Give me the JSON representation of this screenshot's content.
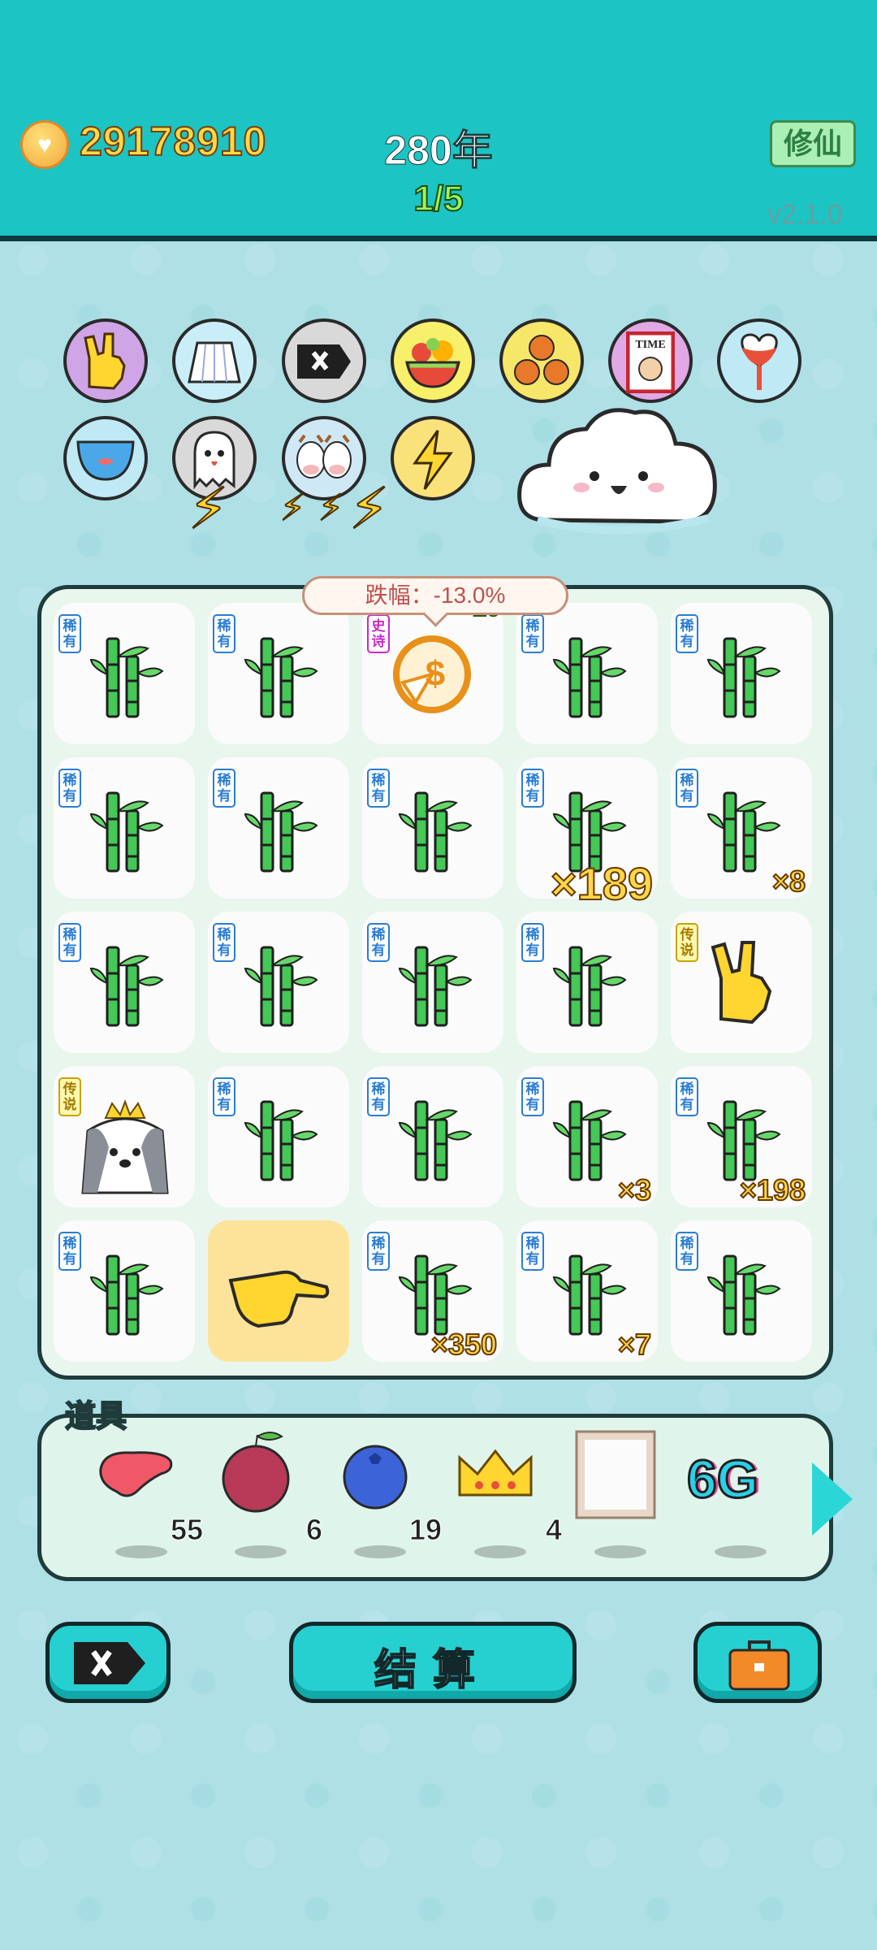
{
  "header": {
    "gold": "29178910",
    "year": "280年",
    "round": "1/5",
    "cultivate_label": "修仙",
    "version": "v2.1.0"
  },
  "powerups": [
    {
      "icon": "rock-hand-icon",
      "bg": "#cfa5e8"
    },
    {
      "icon": "skirt-icon",
      "bg": "#c9eef7"
    },
    {
      "icon": "delete-tag-icon",
      "bg": "#d9d9d9"
    },
    {
      "icon": "fruit-basket-icon",
      "bg": "#f8ef6a"
    },
    {
      "icon": "basketballs-icon",
      "bg": "#f6e66a"
    },
    {
      "icon": "time-magazine-icon",
      "bg": "#e0a8e4"
    },
    {
      "icon": "heart-potion-icon",
      "bg": "#bfe9f5"
    },
    {
      "icon": "fishbowl-icon",
      "bg": "#bfe9f5"
    },
    {
      "icon": "ghost-icon",
      "bg": "#d9d9d9"
    },
    {
      "icon": "cow-pair-icon",
      "bg": "#cfe8f5"
    },
    {
      "icon": "lightning-icon",
      "bg": "#fae27a"
    }
  ],
  "tooltip": "跌幅：-13.0%",
  "badges": {
    "rare": "稀有",
    "legend": "传说",
    "epic": "史诗"
  },
  "grid": [
    {
      "item": "bamboo",
      "badge": "稀有",
      "count": ""
    },
    {
      "item": "bamboo",
      "badge": "稀有",
      "count": ""
    },
    {
      "item": "gold-coin",
      "badge": "史诗",
      "count": "20"
    },
    {
      "item": "bamboo",
      "badge": "稀有",
      "count": ""
    },
    {
      "item": "bamboo",
      "badge": "稀有",
      "count": ""
    },
    {
      "item": "bamboo",
      "badge": "稀有",
      "count": ""
    },
    {
      "item": "bamboo",
      "badge": "稀有",
      "count": ""
    },
    {
      "item": "bamboo",
      "badge": "稀有",
      "count": ""
    },
    {
      "item": "bamboo",
      "badge": "稀有",
      "count": "×189"
    },
    {
      "item": "bamboo",
      "badge": "稀有",
      "count": "×8"
    },
    {
      "item": "bamboo",
      "badge": "稀有",
      "count": ""
    },
    {
      "item": "bamboo",
      "badge": "稀有",
      "count": ""
    },
    {
      "item": "bamboo",
      "badge": "稀有",
      "count": ""
    },
    {
      "item": "bamboo",
      "badge": "稀有",
      "count": ""
    },
    {
      "item": "rock-hand",
      "badge": "传说",
      "count": ""
    },
    {
      "item": "husky-king",
      "badge": "传说",
      "count": ""
    },
    {
      "item": "bamboo",
      "badge": "稀有",
      "count": ""
    },
    {
      "item": "bamboo",
      "badge": "稀有",
      "count": ""
    },
    {
      "item": "bamboo",
      "badge": "稀有",
      "count": "×3"
    },
    {
      "item": "bamboo",
      "badge": "稀有",
      "count": "×198"
    },
    {
      "item": "bamboo",
      "badge": "稀有",
      "count": ""
    },
    {
      "item": "pointing-hand",
      "badge": "",
      "count": ""
    },
    {
      "item": "bamboo",
      "badge": "稀有",
      "count": "×350"
    },
    {
      "item": "bamboo",
      "badge": "稀有",
      "count": "×7"
    },
    {
      "item": "bamboo",
      "badge": "稀有",
      "count": ""
    }
  ],
  "items_title": "道具",
  "items": [
    {
      "icon": "liver-icon",
      "qty": "55"
    },
    {
      "icon": "lychee-icon",
      "qty": "6"
    },
    {
      "icon": "blueberry-icon",
      "qty": "19"
    },
    {
      "icon": "crown-icon",
      "qty": "4"
    },
    {
      "icon": "frame-icon",
      "qty": ""
    },
    {
      "icon": "6g-icon",
      "qty": "",
      "text": "6G"
    }
  ],
  "buttons": {
    "delete_label": "",
    "settle_label": "结算",
    "bag_label": ""
  }
}
